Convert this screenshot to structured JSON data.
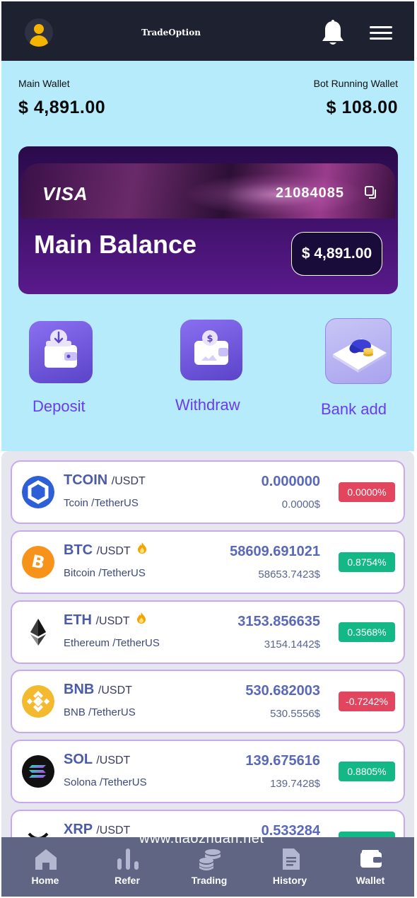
{
  "header": {
    "app_title": "TradeOption",
    "icons": [
      "user-avatar-icon",
      "bell-icon",
      "hamburger-menu-icon"
    ]
  },
  "wallets": {
    "main_label": "Main Wallet",
    "main_value": "$ 4,891.00",
    "bot_label": "Bot Running Wallet",
    "bot_value": "$ 108.00"
  },
  "card": {
    "brand": "VISA",
    "number": "21084085",
    "balance_label": "Main Balance",
    "balance_value": "$ 4,891.00"
  },
  "actions": [
    {
      "label": "Deposit",
      "icon": "wallet-download-icon"
    },
    {
      "label": "Withdraw",
      "icon": "wallet-dollar-icon"
    },
    {
      "label": "Bank add",
      "icon": "bank-coins-icon"
    }
  ],
  "coins": [
    {
      "symbol": "TCOIN",
      "pair": "/USDT",
      "name": "Tcoin /TetherUS",
      "price": "0.000000",
      "usd": "0.0000$",
      "change": "0.0000%",
      "trend": "down",
      "hot": false,
      "logo_color": "#2e5fd6"
    },
    {
      "symbol": "BTC",
      "pair": "/USDT",
      "name": "Bitcoin /TetherUS",
      "price": "58609.691021",
      "usd": "58653.7423$",
      "change": "0.8754%",
      "trend": "up",
      "hot": true,
      "logo_color": "#f7931a"
    },
    {
      "symbol": "ETH",
      "pair": "/USDT",
      "name": "Ethereum /TetherUS",
      "price": "3153.856635",
      "usd": "3154.1442$",
      "change": "0.3568%",
      "trend": "up",
      "hot": true,
      "logo_color": "#ffffff"
    },
    {
      "symbol": "BNB",
      "pair": "/USDT",
      "name": "BNB /TetherUS",
      "price": "530.682003",
      "usd": "530.5556$",
      "change": "-0.7242%",
      "trend": "down",
      "hot": false,
      "logo_color": "#f3ba2f"
    },
    {
      "symbol": "SOL",
      "pair": "/USDT",
      "name": "Solona /TetherUS",
      "price": "139.675616",
      "usd": "139.7428$",
      "change": "0.8805%",
      "trend": "up",
      "hot": false,
      "logo_color": "#111111"
    },
    {
      "symbol": "XRP",
      "pair": "/USDT",
      "name": "",
      "price": "0.533284",
      "usd": "",
      "change": "",
      "trend": "up",
      "hot": false,
      "logo_color": "#111111"
    }
  ],
  "nav": [
    {
      "label": "Home",
      "icon": "home-icon"
    },
    {
      "label": "Refer",
      "icon": "bar-chart-icon"
    },
    {
      "label": "Trading",
      "icon": "coin-stack-icon"
    },
    {
      "label": "History",
      "icon": "document-icon"
    },
    {
      "label": "Wallet",
      "icon": "wallet-icon"
    }
  ],
  "watermark": "www.tiaozhuan.net",
  "colors": {
    "topbar": "#1e2230",
    "wallet_bg": "#b5ebfb",
    "accent_purple": "#6a3cf0",
    "badge_up": "#14b886",
    "badge_down": "#e2465f",
    "nav_bg": "#5f6582"
  }
}
